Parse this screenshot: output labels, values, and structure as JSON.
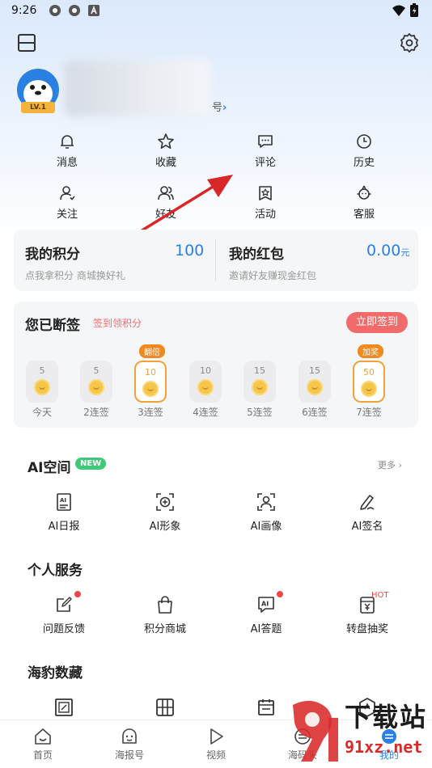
{
  "status_bar": {
    "time": "9:26"
  },
  "profile": {
    "level": "LV.1",
    "account_suffix": "号",
    "account_chevron": "›"
  },
  "quick_actions": [
    {
      "label": "消息",
      "icon": "bell-icon"
    },
    {
      "label": "收藏",
      "icon": "star-icon"
    },
    {
      "label": "评论",
      "icon": "comment-icon"
    },
    {
      "label": "历史",
      "icon": "clock-icon"
    },
    {
      "label": "关注",
      "icon": "follow-icon"
    },
    {
      "label": "好友",
      "icon": "friends-icon"
    },
    {
      "label": "活动",
      "icon": "activity-icon"
    },
    {
      "label": "客服",
      "icon": "support-icon"
    }
  ],
  "points_card": {
    "points_title": "我的积分",
    "points_value": "100",
    "points_sub": "点我拿积分 商城换好礼",
    "redpacket_title": "我的红包",
    "redpacket_value": "0.00",
    "redpacket_unit": "元",
    "redpacket_sub": "邀请好友赚现金红包"
  },
  "signin": {
    "title": "您已断签",
    "subtitle": "签到领积分",
    "button": "立即签到",
    "days": [
      {
        "points": "5",
        "label": "今天",
        "tag": ""
      },
      {
        "points": "5",
        "label": "2连签",
        "tag": ""
      },
      {
        "points": "10",
        "label": "3连签",
        "tag": "翻倍"
      },
      {
        "points": "10",
        "label": "4连签",
        "tag": ""
      },
      {
        "points": "15",
        "label": "5连签",
        "tag": ""
      },
      {
        "points": "15",
        "label": "6连签",
        "tag": ""
      },
      {
        "points": "50",
        "label": "7连签",
        "tag": "加奖"
      }
    ]
  },
  "ai_space": {
    "title": "AI空间",
    "badge": "NEW",
    "more": "更多 ›",
    "items": [
      {
        "label": "AI日报",
        "icon": "ai-daily-icon"
      },
      {
        "label": "AI形象",
        "icon": "ai-avatar-icon"
      },
      {
        "label": "AI画像",
        "icon": "ai-portrait-icon"
      },
      {
        "label": "AI签名",
        "icon": "ai-signature-icon"
      }
    ]
  },
  "personal_service": {
    "title": "个人服务",
    "hot": "HOT",
    "items": [
      {
        "label": "问题反馈",
        "icon": "feedback-icon"
      },
      {
        "label": "积分商城",
        "icon": "shopping-bag-icon"
      },
      {
        "label": "AI答题",
        "icon": "ai-quiz-icon"
      },
      {
        "label": "转盘抽奖",
        "icon": "lottery-icon"
      }
    ]
  },
  "seal_collection": {
    "title": "海豹数藏"
  },
  "bottom_nav": [
    {
      "label": "首页",
      "icon": "home-icon"
    },
    {
      "label": "海报号",
      "icon": "poster-icon"
    },
    {
      "label": "视频",
      "icon": "play-icon"
    },
    {
      "label": "海码头",
      "icon": "dock-icon"
    },
    {
      "label": "我的",
      "icon": "profile-icon"
    }
  ],
  "watermark": {
    "text_top": "下载站",
    "text_bottom": "91xz.net"
  },
  "colors": {
    "accent": "#2b7fe6",
    "signin_button": "#f26b6b",
    "signin_highlight": "#f2a23a",
    "new_badge": "#3ec97a"
  }
}
